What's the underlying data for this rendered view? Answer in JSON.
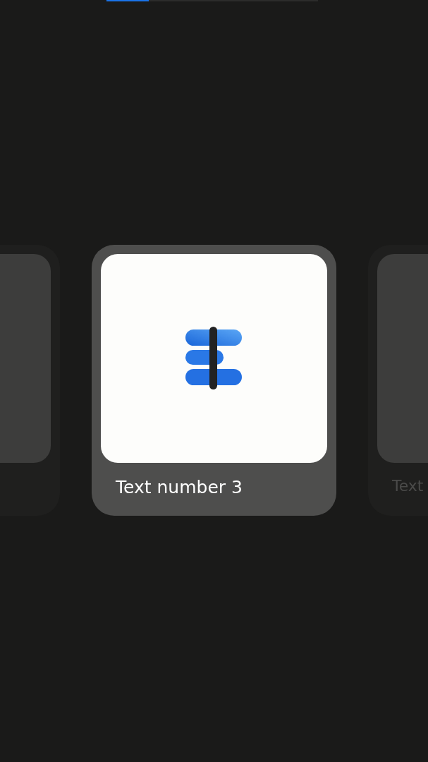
{
  "progress": {
    "level": 0.2
  },
  "cards": [
    {
      "selected": false
    },
    {
      "selected": true,
      "label": "Text number 3"
    },
    {
      "selected": false,
      "label": "Text"
    }
  ]
}
